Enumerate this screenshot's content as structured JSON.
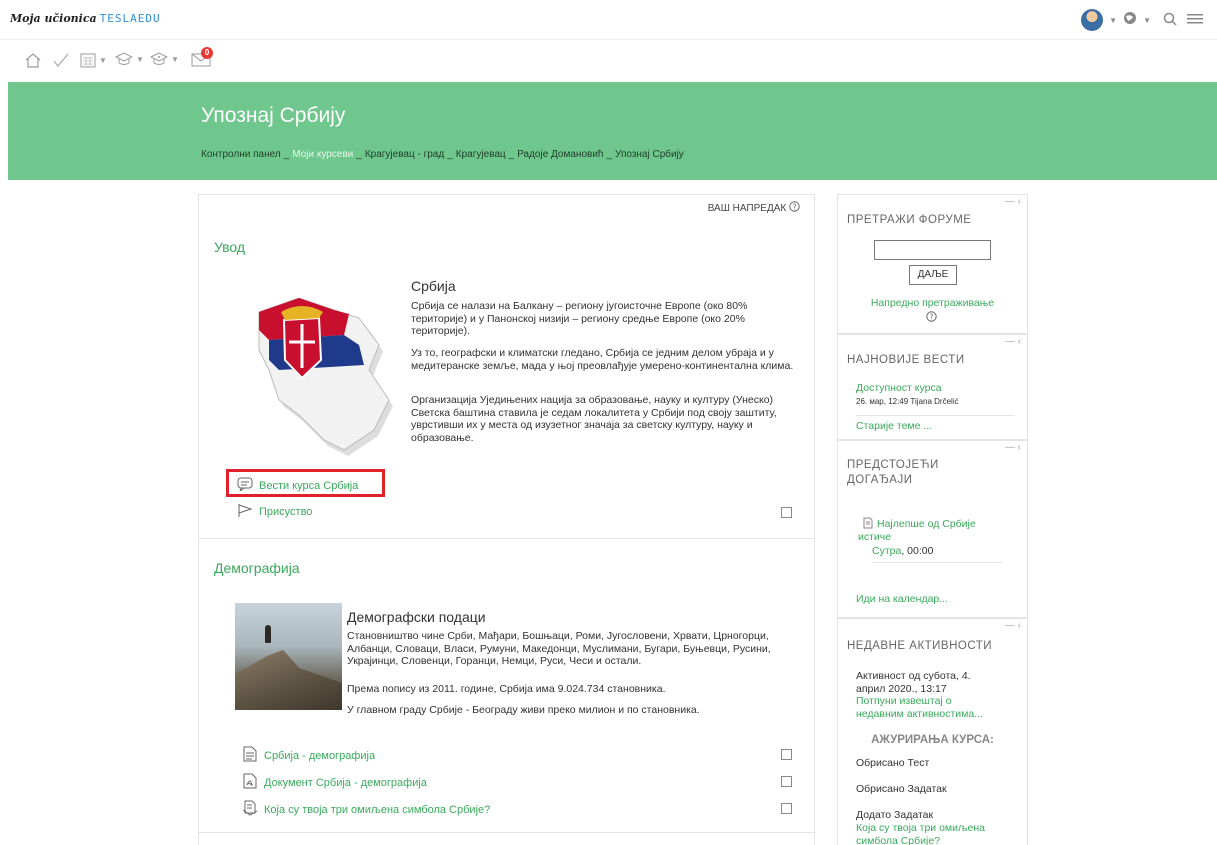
{
  "brand": {
    "name": "Moja učionica",
    "suffix": "TESLAEDU"
  },
  "topbar": {
    "icons": [
      "avatar",
      "globe-icon",
      "search-icon",
      "menu-icon"
    ]
  },
  "iconbar": {
    "mail_badge": "0"
  },
  "course": {
    "title": "Упознај Србију",
    "breadcrumbs": [
      "Контролни панел",
      "Моји курсеви",
      "Крагујевац - град",
      "Крагујевац",
      "Радоје Домановић",
      "Упознај Србију"
    ]
  },
  "main": {
    "progress_label": "ВАШ НАПРЕДАК",
    "sections": [
      {
        "title": "Увод",
        "label_title": "Србија",
        "paragraphs": [
          "Србија се налази на Балкану – региону југоисточне Европе (око 80% територије) и у Панонској низији – региону средње Европе (око 20% територије).",
          "Уз то, географски и климатски гледано, Србија се једним делом убраја и у медитеранске земље, мада у њој преовлађује умерено-континентална клима.",
          "Организација Уједињених нација за образовање, науку и културу (Унеско) Светска баштина ставила је седам локалитета у Србији под своју заштиту, уврстивши их у места од изузетног значаја за светску културу, науку и образовање."
        ],
        "activities": [
          "Вести курса Србија",
          "Присуство"
        ]
      },
      {
        "title": "Демографија",
        "label_title": "Демографски подаци",
        "paragraphs": [
          "Становништво чине Срби, Мађари, Бошњаци, Роми, Југословени, Хрвати, Црногорци, Албанци, Словаци, Власи, Румуни, Македонци, Муслимани, Бугари, Буњевци, Русини, Украјинци, Словенци, Горанци, Немци, Руси, Чеси и остали.",
          "Према попису из 2011. године, Србија има 9.024.734 становника.",
          "У главном граду Србије - Београду живи преко милион и по становника."
        ],
        "activities": [
          "Србија - демографија",
          "Документ Србија - демографија",
          "Која су твоја три омиљена симбола Србије?"
        ]
      }
    ]
  },
  "sidebar": {
    "search": {
      "title": "ПРЕТРАЖИ ФОРУМЕ",
      "button": "ДАЉЕ",
      "advanced": "Напредно претраживање"
    },
    "news": {
      "title": "НАЈНОВИЈЕ ВЕСТИ",
      "item": "Доступност курса",
      "meta": "26. мар, 12:49 Tijana Drčelić",
      "older": "Старије теме ..."
    },
    "events": {
      "title_line1": "ПРЕДСТОЈЕЋИ",
      "title_line2": "ДОГАЂАЈИ",
      "event_line1": "Најлепше од Србије",
      "event_line2": "истиче",
      "when_link": "Сутра",
      "when_time": ", 00:00",
      "calendar": "Иди на календар..."
    },
    "recent": {
      "title": "НЕДАВНЕ АКТИВНОСТИ",
      "since_line1": "Активност од субота, 4.",
      "since_line2": "април 2020., 13:17",
      "full_line1": "Потпуни извештај о",
      "full_line2": "недавним активностима...",
      "updates_title": "АЖУРИРАЊА КУРСА:",
      "updates": [
        "Обрисано Тест",
        "Обрисано Задатак",
        "Додато Задатак"
      ],
      "last_link_line1": "Која су твоја три омиљена",
      "last_link_line2": "симбола Србије?"
    }
  },
  "colors": {
    "accent": "#3aaa5c",
    "hero": "#6fc78d",
    "highlight": "#e0202b"
  }
}
